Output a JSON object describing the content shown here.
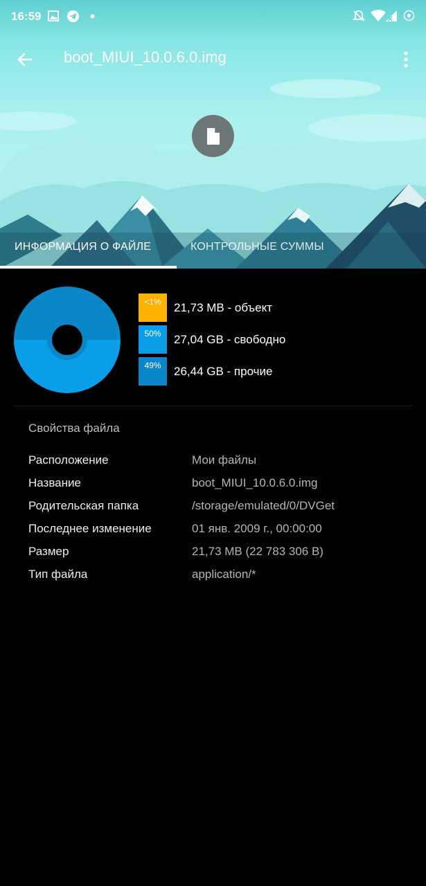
{
  "status_bar": {
    "time": "16:59",
    "icons": [
      "gallery-icon",
      "telegram-icon",
      "dot-icon",
      "mute-icon",
      "wifi-icon",
      "signal-icon",
      "battery-icon"
    ]
  },
  "toolbar": {
    "title": "boot_MIUI_10.0.6.0.img"
  },
  "tabs": [
    {
      "label": "ИНФОРМАЦИЯ О ФАЙЛЕ",
      "active": true
    },
    {
      "label": "КОНТРОЛЬНЫЕ СУММЫ",
      "active": false
    }
  ],
  "storage": {
    "legend": [
      {
        "percent": "<1%",
        "label": "21,73 MB - объект",
        "color": "#fdb000"
      },
      {
        "percent": "50%",
        "label": "27,04 GB - свободно",
        "color": "#0a9ee8"
      },
      {
        "percent": "49%",
        "label": "26,44 GB - прочие",
        "color": "#0a87c8"
      }
    ]
  },
  "properties": {
    "title": "Свойства файла",
    "rows": [
      {
        "key": "Расположение",
        "value": "Мои файлы"
      },
      {
        "key": "Название",
        "value": "boot_MIUI_10.0.6.0.img"
      },
      {
        "key": "Родительская папка",
        "value": "/storage/emulated/0/DVGet"
      },
      {
        "key": "Последнее изменение",
        "value": "01 янв. 2009 г., 00:00:00"
      },
      {
        "key": "Размер",
        "value": "21,73 MB (22 783 306 B)"
      },
      {
        "key": "Тип файла",
        "value": "application/*"
      }
    ]
  }
}
